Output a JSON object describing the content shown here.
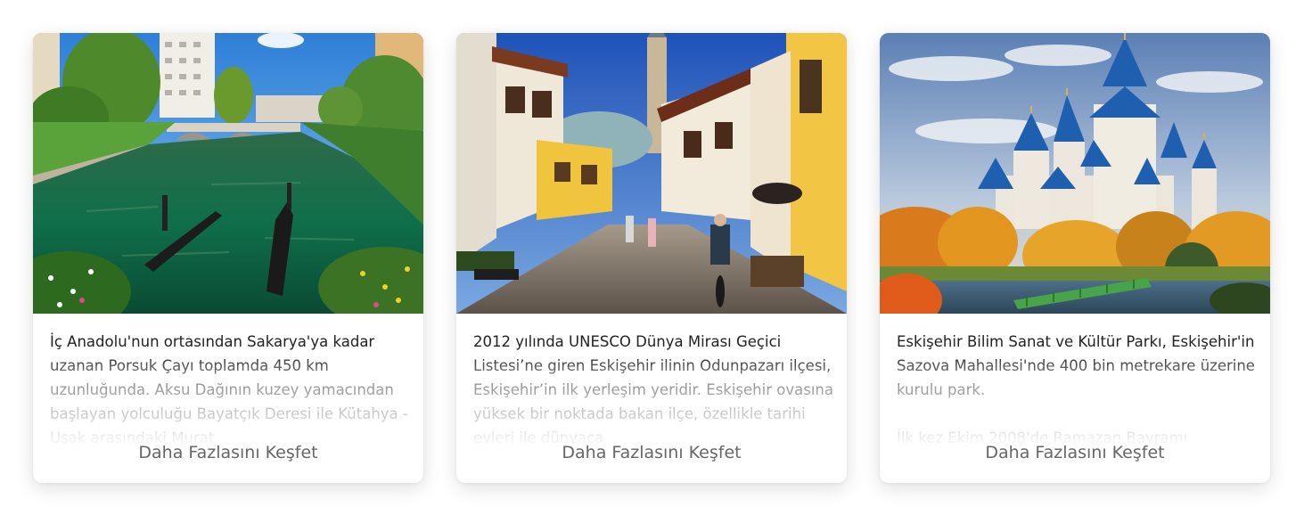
{
  "cards": [
    {
      "image_alt": "Porsuk Çayı gondola",
      "text_p1": "İç Anadolu'nun ortasından Sakarya'ya kadar uzanan Porsuk Çayı toplamda 450 km uzunluğunda. Aksu Dağının kuzey yamacından başlayan yolculuğu Bayatçık Deresi ile Kütahya - Uşak arasındaki Murat",
      "text_p2": "",
      "link": "Daha Fazlasını Keşfet"
    },
    {
      "image_alt": "Odunpazarı street",
      "text_p1": "2012 yılında UNESCO Dünya Mirası Geçici Listesi’ne giren Eskişehir ilinin Odunpazarı ilçesi, Eskişehir’in ilk yerleşim yeridir. Eskişehir ovasına yüksek bir noktada bakan ilçe, özellikle tarihi evleri ile dünyaca",
      "text_p2": "",
      "link": "Daha Fazlasını Keşfet"
    },
    {
      "image_alt": "Sazova castle",
      "text_p1": "Eskişehir Bilim Sanat ve Kültür Parkı, Eskişehir'in Sazova Mahallesi'nde 400 bin metrekare üzerine kurulu park.",
      "text_p2": "İlk kez Ekim 2008'de Ramazan Bayramı",
      "link": "Daha Fazlasını Keşfet"
    }
  ]
}
